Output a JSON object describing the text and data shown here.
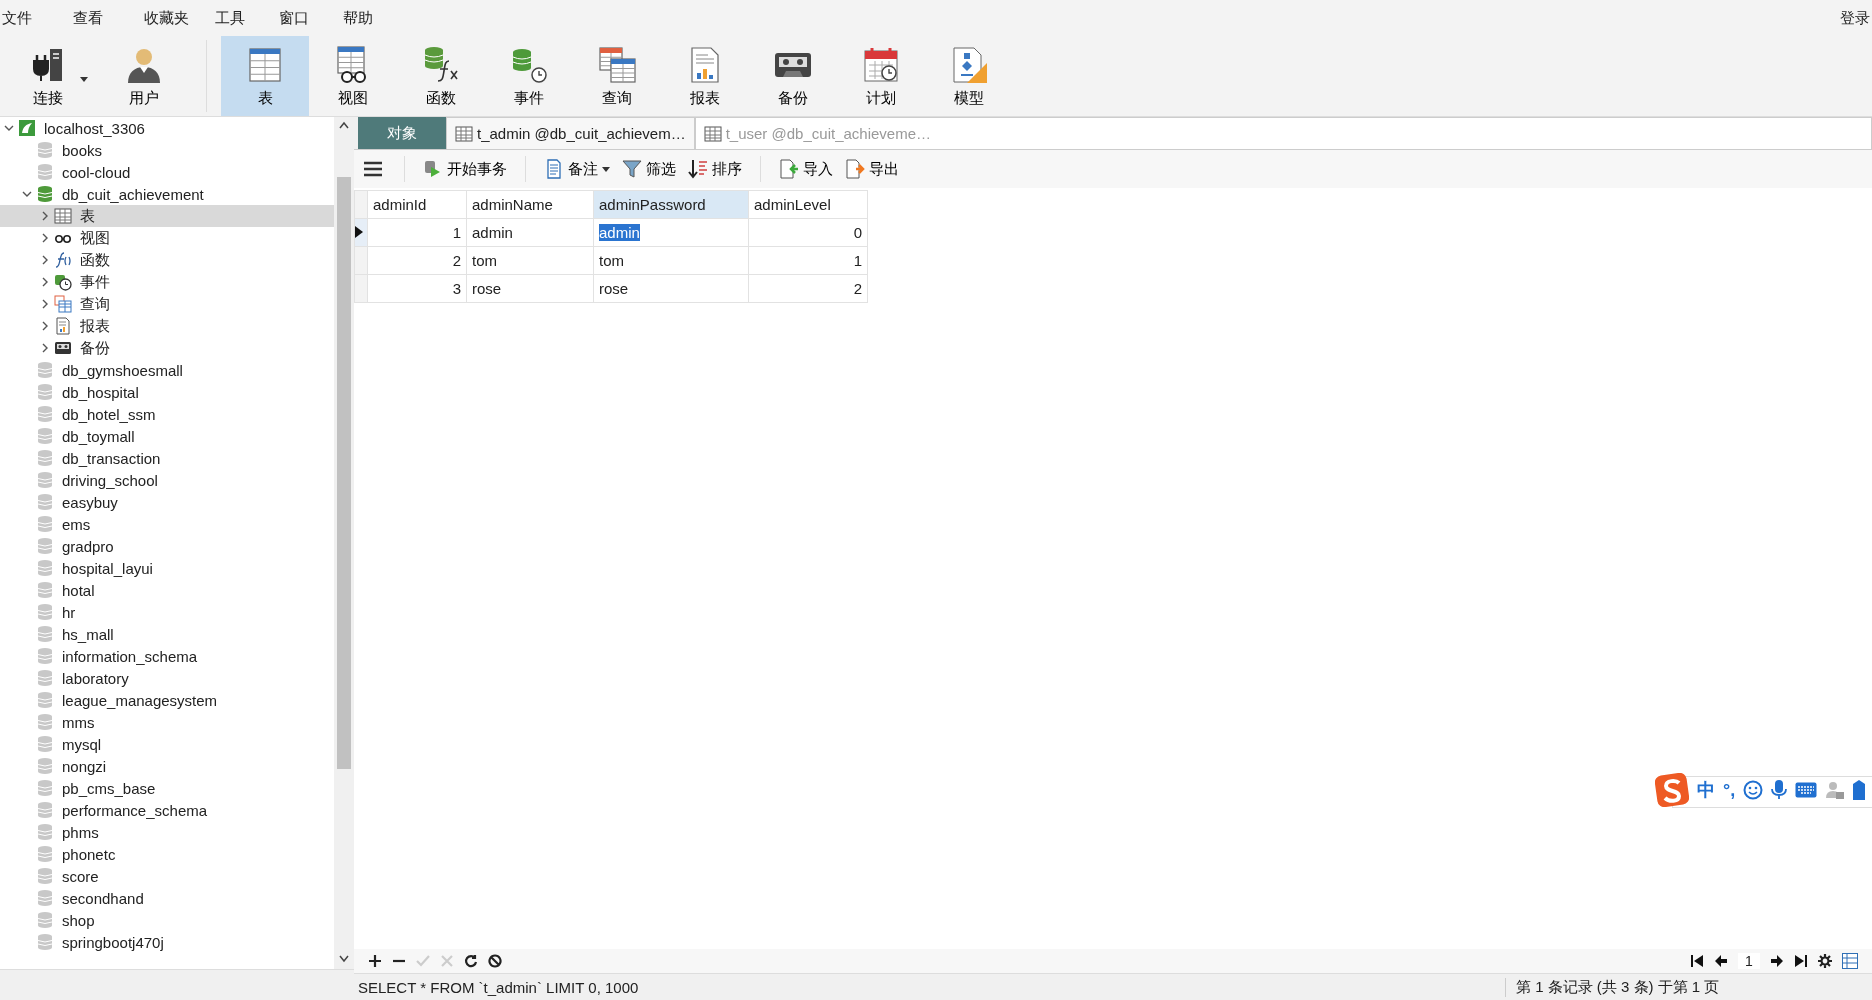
{
  "menu": [
    "文件",
    "查看",
    "收藏夹",
    "工具",
    "窗口",
    "帮助"
  ],
  "login": "登录",
  "connection_tools": [
    {
      "kind": "connection",
      "label": "连接",
      "dropdown": true,
      "selected": false
    },
    {
      "kind": "user",
      "label": "用户",
      "dropdown": false,
      "selected": false
    }
  ],
  "object_tools": [
    {
      "kind": "table",
      "label": "表",
      "selected": true
    },
    {
      "kind": "view",
      "label": "视图",
      "selected": false
    },
    {
      "kind": "function",
      "label": "函数",
      "selected": false
    },
    {
      "kind": "event",
      "label": "事件",
      "selected": false
    },
    {
      "kind": "query",
      "label": "查询",
      "selected": false
    },
    {
      "kind": "report",
      "label": "报表",
      "selected": false
    },
    {
      "kind": "backup",
      "label": "备份",
      "selected": false
    },
    {
      "kind": "schedule",
      "label": "计划",
      "selected": false
    },
    {
      "kind": "model",
      "label": "模型",
      "selected": false
    }
  ],
  "tree": [
    {
      "kind": "connection",
      "label": "localhost_3306",
      "expanded": true,
      "selected": false,
      "children": [
        {
          "kind": "database",
          "label": "books",
          "selected": false
        },
        {
          "kind": "database",
          "label": "cool-cloud",
          "selected": false
        },
        {
          "kind": "database",
          "label": "db_cuit_achievement",
          "expanded": true,
          "selected": false,
          "children": [
            {
              "kind": "table",
              "label": "表",
              "expanded": false,
              "selected": true
            },
            {
              "kind": "view",
              "label": "视图",
              "expanded": false,
              "selected": false
            },
            {
              "kind": "function",
              "label": "函数",
              "expanded": false,
              "selected": false
            },
            {
              "kind": "event",
              "label": "事件",
              "expanded": false,
              "selected": false
            },
            {
              "kind": "query",
              "label": "查询",
              "expanded": false,
              "selected": false
            },
            {
              "kind": "report",
              "label": "报表",
              "expanded": false,
              "selected": false
            },
            {
              "kind": "backup",
              "label": "备份",
              "expanded": false,
              "selected": false
            }
          ]
        },
        {
          "kind": "database",
          "label": "db_gymshoesmall",
          "selected": false
        },
        {
          "kind": "database",
          "label": "db_hospital",
          "selected": false
        },
        {
          "kind": "database",
          "label": "db_hotel_ssm",
          "selected": false
        },
        {
          "kind": "database",
          "label": "db_toymall",
          "selected": false
        },
        {
          "kind": "database",
          "label": "db_transaction",
          "selected": false
        },
        {
          "kind": "database",
          "label": "driving_school",
          "selected": false
        },
        {
          "kind": "database",
          "label": "easybuy",
          "selected": false
        },
        {
          "kind": "database",
          "label": "ems",
          "selected": false
        },
        {
          "kind": "database",
          "label": "gradpro",
          "selected": false
        },
        {
          "kind": "database",
          "label": "hospital_layui",
          "selected": false
        },
        {
          "kind": "database",
          "label": "hotal",
          "selected": false
        },
        {
          "kind": "database",
          "label": "hr",
          "selected": false
        },
        {
          "kind": "database",
          "label": "hs_mall",
          "selected": false
        },
        {
          "kind": "database",
          "label": "information_schema",
          "selected": false
        },
        {
          "kind": "database",
          "label": "laboratory",
          "selected": false
        },
        {
          "kind": "database",
          "label": "league_managesystem",
          "selected": false
        },
        {
          "kind": "database",
          "label": "mms",
          "selected": false
        },
        {
          "kind": "database",
          "label": "mysql",
          "selected": false
        },
        {
          "kind": "database",
          "label": "nongzi",
          "selected": false
        },
        {
          "kind": "database",
          "label": "pb_cms_base",
          "selected": false
        },
        {
          "kind": "database",
          "label": "performance_schema",
          "selected": false
        },
        {
          "kind": "database",
          "label": "phms",
          "selected": false
        },
        {
          "kind": "database",
          "label": "phonetc",
          "selected": false
        },
        {
          "kind": "database",
          "label": "score",
          "selected": false
        },
        {
          "kind": "database",
          "label": "secondhand",
          "selected": false
        },
        {
          "kind": "database",
          "label": "shop",
          "selected": false
        },
        {
          "kind": "database",
          "label": "springbootj470j",
          "selected": false
        }
      ]
    }
  ],
  "tabs": [
    {
      "kind": "objects",
      "label": "对象",
      "selected": false
    },
    {
      "kind": "table",
      "label": "t_admin @db_cuit_achievem…",
      "selected": true
    },
    {
      "kind": "table",
      "label": "t_user @db_cuit_achieveme…",
      "selected": false
    }
  ],
  "grid_toolbar": [
    {
      "kind": "transaction",
      "label": "开始事务",
      "dropdown": false
    },
    {
      "kind": "memo",
      "label": "备注",
      "dropdown": true
    },
    {
      "kind": "filter",
      "label": "筛选",
      "dropdown": false
    },
    {
      "kind": "sort",
      "label": "排序",
      "dropdown": false
    },
    {
      "kind": "import",
      "label": "导入",
      "dropdown": false
    },
    {
      "kind": "export",
      "label": "导出",
      "dropdown": false
    }
  ],
  "grid": {
    "columns": [
      {
        "label": "adminId",
        "kind": "number",
        "selected": false
      },
      {
        "label": "adminName",
        "kind": "text",
        "selected": false
      },
      {
        "label": "adminPassword",
        "kind": "text",
        "selected": true
      },
      {
        "label": "adminLevel",
        "kind": "number",
        "selected": false
      }
    ],
    "rows": [
      {
        "selected": true,
        "cells": [
          "1",
          "admin",
          "admin",
          "0"
        ]
      },
      {
        "selected": false,
        "cells": [
          "2",
          "tom",
          "tom",
          "1"
        ]
      },
      {
        "selected": false,
        "cells": [
          "3",
          "rose",
          "rose",
          "2"
        ]
      }
    ]
  },
  "page": "1",
  "status": {
    "sql": "SELECT * FROM `t_admin` LIMIT 0, 1000",
    "records": "第 1 条记录 (共 3 条) 于第 1 页"
  },
  "ime_bar": {
    "mode": "中",
    "punctuation": "°,"
  }
}
